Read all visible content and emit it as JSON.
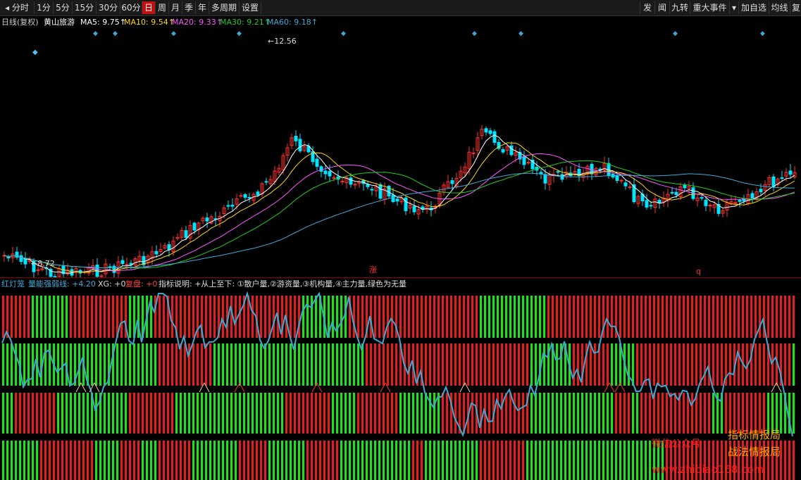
{
  "toolbar": {
    "arrow": "◂",
    "tabs": [
      "分时",
      "1分",
      "5分",
      "15分",
      "30分",
      "60分",
      "日",
      "周",
      "月",
      "季",
      "年",
      "多周期",
      "设置"
    ],
    "active_tab": "日",
    "right_tabs": [
      "发",
      "闻",
      "九转",
      "重大事件",
      "▾",
      "加自选",
      "均线",
      "复"
    ]
  },
  "info": {
    "period": "日线(复权)",
    "name": "黄山旅游",
    "ma5_label": "MA5: 9.75↑",
    "ma10_label": "MA10: 9.54↑",
    "ma20_label": "MA20: 9.33↑",
    "ma30_label": "MA30: 9.21↑",
    "ma60_label": "MA60: 9.18↑",
    "colors": {
      "ma5": "#ffffff",
      "ma10": "#ffd700",
      "ma20": "#ff55ff",
      "ma30": "#22cc22",
      "ma60": "#3fa9d6"
    }
  },
  "price_chart": {
    "high_mark": "12.56",
    "low_mark": "8.72",
    "signal_up": "涨",
    "signal_q": "q"
  },
  "indicator": {
    "name": "红灯笼",
    "line_label": "量能强弱线: +4.20",
    "xg_label": "XG: +0",
    "fupan_label": "复盘: +0",
    "desc": "指标说明: +从上至下: ①散户量,②游资量,③机构量,④主力量,绿色为无量"
  },
  "watermark": {
    "line1": "微信公众号",
    "line2": "指标情报局",
    "line3": "战法情报局",
    "url": "www.zhibiao168.com"
  },
  "chart_data": {
    "type": "candlestick",
    "price_range": [
      8.72,
      12.56
    ],
    "ma_values_latest": {
      "MA5": 9.75,
      "MA10": 9.54,
      "MA20": 9.33,
      "MA30": 9.21,
      "MA60": 9.18
    }
  }
}
